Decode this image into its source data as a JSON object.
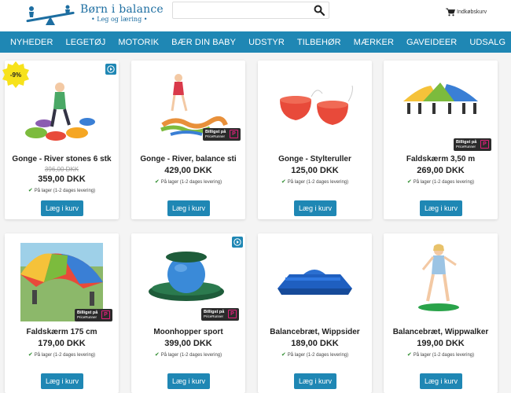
{
  "header": {
    "logo_title": "Børn i balance",
    "logo_sub": "• Leg og læring •",
    "search_placeholder": "",
    "cart_label": "Indkøbskurv"
  },
  "nav": [
    "NYHEDER",
    "LEGETØJ",
    "MOTORIK",
    "BÆR DIN BABY",
    "UDSTYR",
    "TILBEHØR",
    "MÆRKER",
    "GAVEIDEER",
    "UDSALG"
  ],
  "products": [
    {
      "name": "Gonge - River stones 6 stk",
      "old_price": "396,00 DKK",
      "price": "359,00 DKK",
      "stock": "På lager (1-2 dages levering)",
      "button": "Læg i kurv",
      "discount": "-9%",
      "badge": "",
      "video": true
    },
    {
      "name": "Gonge - River, balance sti",
      "old_price": "",
      "price": "429,00 DKK",
      "stock": "På lager (1-2 dages levering)",
      "button": "Læg i kurv",
      "discount": "",
      "badge": "Billigst på PriceRunner",
      "video": false
    },
    {
      "name": "Gonge - Stylteruller",
      "old_price": "",
      "price": "125,00 DKK",
      "stock": "På lager (1-2 dages levering)",
      "button": "Læg i kurv",
      "discount": "",
      "badge": "",
      "video": false
    },
    {
      "name": "Faldskærm 3,50 m",
      "old_price": "",
      "price": "269,00 DKK",
      "stock": "På lager (1-2 dages levering)",
      "button": "Læg i kurv",
      "discount": "",
      "badge": "Billigst på PriceRunner",
      "video": false
    },
    {
      "name": "Faldskærm 175 cm",
      "old_price": "",
      "price": "179,00 DKK",
      "stock": "På lager (1-2 dages levering)",
      "button": "Læg i kurv",
      "discount": "",
      "badge": "Billigst på PriceRunner",
      "video": false
    },
    {
      "name": "Moonhopper sport",
      "old_price": "",
      "price": "399,00 DKK",
      "stock": "På lager (1-2 dages levering)",
      "button": "Læg i kurv",
      "discount": "",
      "badge": "Billigst på PriceRunner",
      "video": true
    },
    {
      "name": "Balancebræt, Wippsider",
      "old_price": "",
      "price": "189,00 DKK",
      "stock": "På lager (1-2 dages levering)",
      "button": "Læg i kurv",
      "discount": "",
      "badge": "",
      "video": false
    },
    {
      "name": "Balancebræt, Wippwalker",
      "old_price": "",
      "price": "199,00 DKK",
      "stock": "På lager (1-2 dages levering)",
      "button": "Læg i kurv",
      "discount": "",
      "badge": "",
      "video": false
    }
  ],
  "colors": {
    "accent": "#1f87b4",
    "discount": "#f7e21b"
  }
}
